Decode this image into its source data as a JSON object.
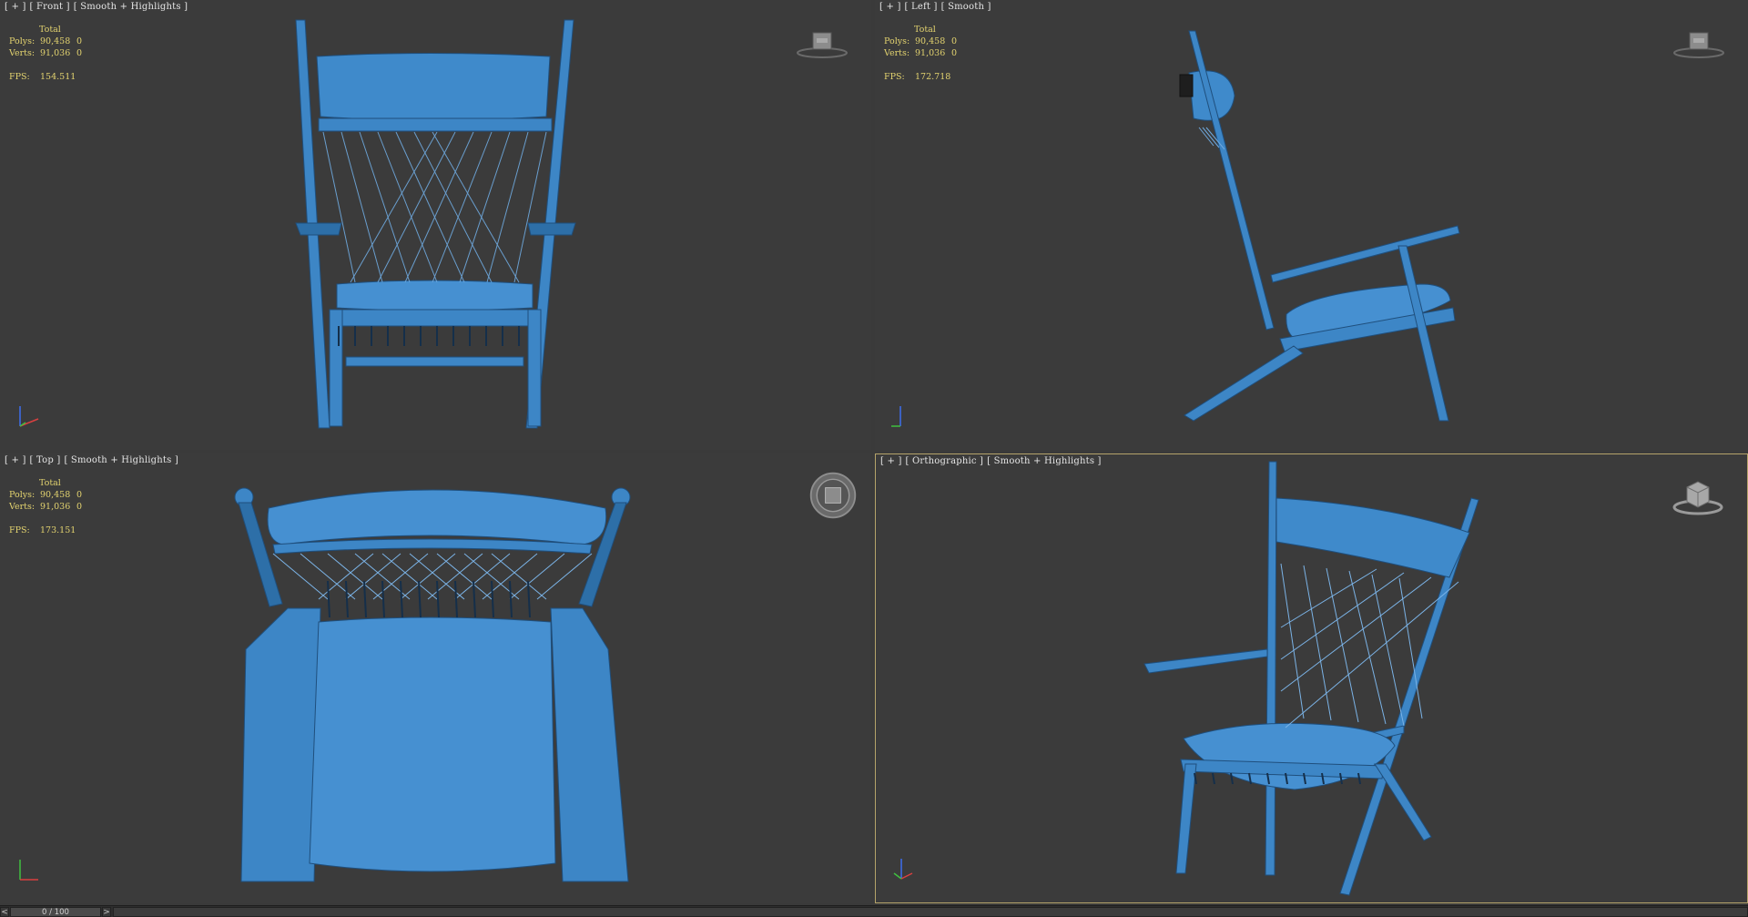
{
  "viewports": [
    {
      "id": "front",
      "label": [
        "[ + ]",
        "[ Front ]",
        "[ Smooth + Highlights ]"
      ],
      "stats": {
        "total": "Total",
        "polys_label": "Polys:",
        "polys": "90,458",
        "polys_sel": "0",
        "verts_label": "Verts:",
        "verts": "91,036",
        "verts_sel": "0",
        "fps_label": "FPS:",
        "fps": "154.511"
      }
    },
    {
      "id": "left",
      "label": [
        "[ + ]",
        "[ Left ]",
        "[ Smooth ]"
      ],
      "stats": {
        "total": "Total",
        "polys_label": "Polys:",
        "polys": "90,458",
        "polys_sel": "0",
        "verts_label": "Verts:",
        "verts": "91,036",
        "verts_sel": "0",
        "fps_label": "FPS:",
        "fps": "172.718"
      }
    },
    {
      "id": "top",
      "label": [
        "[ + ]",
        "[ Top ]",
        "[ Smooth + Highlights ]"
      ],
      "stats": {
        "total": "Total",
        "polys_label": "Polys:",
        "polys": "90,458",
        "polys_sel": "0",
        "verts_label": "Verts:",
        "verts": "91,036",
        "verts_sel": "0",
        "fps_label": "FPS:",
        "fps": "173.151"
      }
    },
    {
      "id": "ortho",
      "label": [
        "[ + ]",
        "[ Orthographic ]",
        "[ Smooth + Highlights ]"
      ],
      "stats": null
    }
  ],
  "timeline": {
    "prev": "<",
    "next": ">",
    "frame": "0 / 100",
    "current_frame": 0,
    "total_frames": 100
  },
  "colors": {
    "model": "#3d86c6",
    "model_dark": "#2b6aa3",
    "background": "#3b3b3b",
    "stats_text": "#e3d36f",
    "active_border": "#b5a36a"
  },
  "icons": {
    "viewcube": "viewcube-icon",
    "axis": "axis-tripod-icon",
    "steering_wheel": "steering-wheel-icon"
  }
}
